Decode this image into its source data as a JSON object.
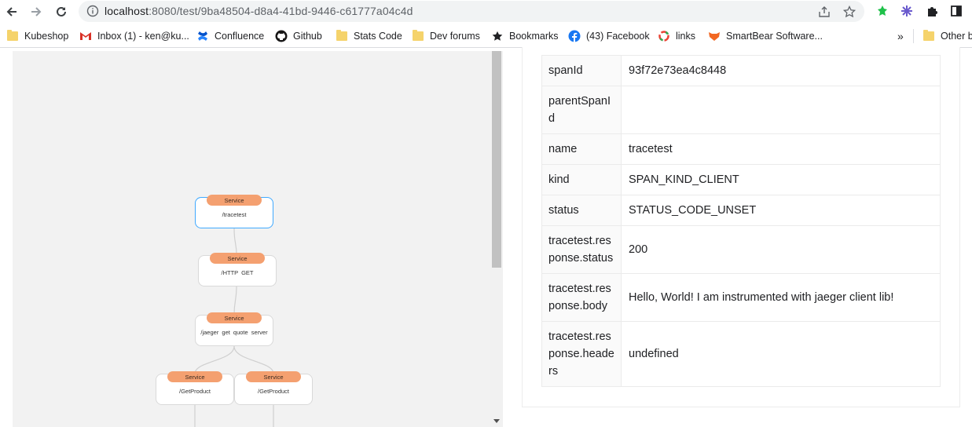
{
  "browser": {
    "url_host": "localhost",
    "url_rest": ":8080/test/9ba48504-d8a4-41bd-9446-c61777a04c4d",
    "bookmarks": [
      {
        "label": "Kubeshop",
        "icon": "folder-icon"
      },
      {
        "label": "Inbox (1) - ken@ku...",
        "icon": "gmail-icon"
      },
      {
        "label": "Confluence",
        "icon": "confluence-icon"
      },
      {
        "label": "Github",
        "icon": "github-icon"
      },
      {
        "label": "Stats Code",
        "icon": "folder-icon"
      },
      {
        "label": "Dev forums",
        "icon": "folder-icon"
      },
      {
        "label": "Bookmarks",
        "icon": "star-icon"
      },
      {
        "label": "(43) Facebook",
        "icon": "facebook-icon"
      },
      {
        "label": "links",
        "icon": "links-icon"
      },
      {
        "label": "SmartBear Software...",
        "icon": "smartbear-icon"
      }
    ],
    "overflow_label": "»",
    "other_bookmarks": "Other b"
  },
  "diagram": {
    "nodes": [
      {
        "badge": "Service",
        "label": "/tracetest",
        "selected": true
      },
      {
        "badge": "Service",
        "label": "/HTTP GET",
        "selected": false
      },
      {
        "badge": "Service",
        "label": "/jaeger get quote server",
        "selected": false
      },
      {
        "badge": "Service",
        "label": "/GetProduct",
        "selected": false
      },
      {
        "badge": "Service",
        "label": "/GetProduct",
        "selected": false
      }
    ],
    "colors": {
      "badge": "#f4a070",
      "selected_border": "#40a9ff"
    }
  },
  "attributes": [
    {
      "key": "spanId",
      "value": "93f72e73ea4c8448"
    },
    {
      "key": "parentSpanId",
      "value": ""
    },
    {
      "key": "name",
      "value": "tracetest"
    },
    {
      "key": "kind",
      "value": "SPAN_KIND_CLIENT"
    },
    {
      "key": "status",
      "value": "STATUS_CODE_UNSET"
    },
    {
      "key": "tracetest.response.status",
      "value": "200"
    },
    {
      "key": "tracetest.response.body",
      "value": "Hello, World! I am instrumented with jaeger client lib!"
    },
    {
      "key": "tracetest.response.headers",
      "value": "undefined"
    }
  ]
}
